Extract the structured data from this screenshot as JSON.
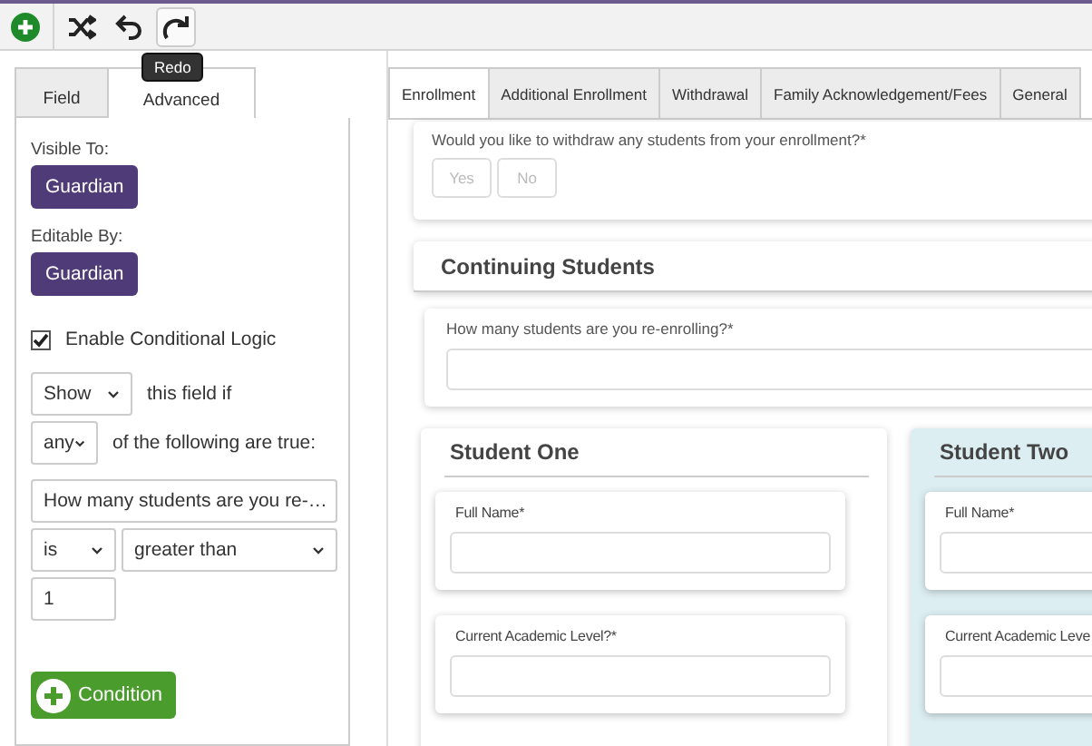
{
  "toolbar": {
    "buttons": [
      {
        "kind": "add"
      },
      {
        "kind": "shuffle"
      },
      {
        "kind": "undo"
      },
      {
        "kind": "redo"
      }
    ],
    "tooltip": "Redo"
  },
  "settings_panel": {
    "tabs": [
      {
        "label": "Field",
        "selected": false
      },
      {
        "label": "Advanced",
        "selected": true
      }
    ],
    "visible_to": {
      "label": "Visible To:",
      "button": "Guardian"
    },
    "editable_by": {
      "label": "Editable By:",
      "button": "Guardian"
    },
    "conditional_logic": {
      "label": "Enable Conditional Logic",
      "checked": true
    },
    "action_select": "Show",
    "action_text": "this field if",
    "match_select": "any",
    "match_text": "of the following are true:",
    "condition": {
      "field": "How many students are you re-…",
      "operator": "is",
      "comparison": "greater than",
      "value": "1"
    },
    "add_condition_button": "Condition"
  },
  "form": {
    "tabs": [
      {
        "label": "Enrollment",
        "selected": true
      },
      {
        "label": "Additional Enrollment",
        "selected": false
      },
      {
        "label": "Withdrawal",
        "selected": false
      },
      {
        "label": "Family Acknowledgement/Fees",
        "selected": false
      },
      {
        "label": "General",
        "selected": false
      }
    ],
    "withdraw_question": {
      "label": "Would you like to withdraw any students from your enrollment?*",
      "options": [
        {
          "label": "Yes",
          "disabled": true
        },
        {
          "label": "No",
          "disabled": true
        }
      ]
    },
    "section_title": "Continuing Students",
    "reenroll_question": "How many students are you re-enrolling?*",
    "students": [
      {
        "title": "Student One",
        "highlighted": false,
        "fields": [
          "Full Name*",
          "Current Academic Level?*"
        ]
      },
      {
        "title": "Student Two",
        "highlighted": true,
        "fields": [
          "Full Name*",
          "Current Academic Leve"
        ]
      }
    ]
  }
}
